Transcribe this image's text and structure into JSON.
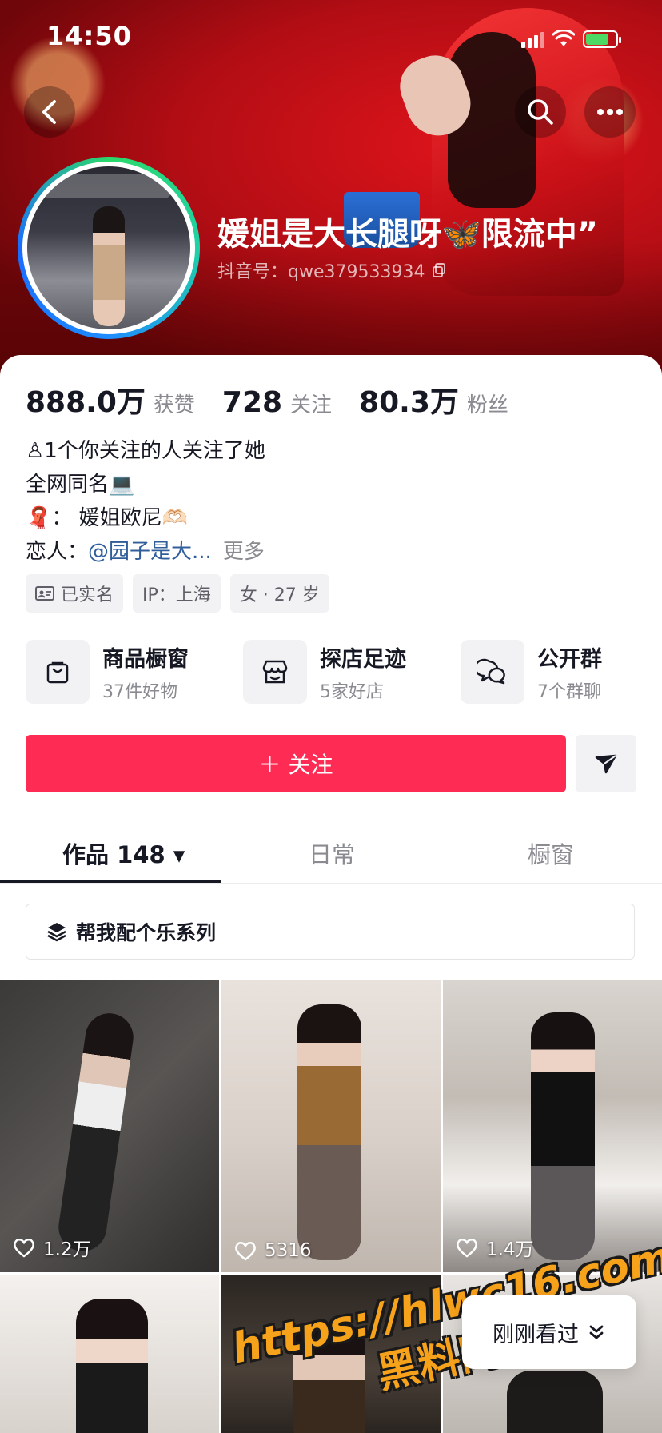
{
  "status_bar": {
    "time": "14:50"
  },
  "profile": {
    "nickname": "媛姐是大长腿呀🦋限流中”",
    "douyin_id": "抖音号：qwe379533934"
  },
  "stats": [
    {
      "value": "888.0万",
      "label": "获赞"
    },
    {
      "value": "728",
      "label": "关注"
    },
    {
      "value": "80.3万",
      "label": "粉丝"
    }
  ],
  "bio": {
    "mutual": "♙1个你关注的人关注了她",
    "line2": "全网同名💻",
    "line3": "🧣： 媛姐欧尼🫶🏻",
    "lover_label": "恋人：",
    "lover_link": "@园子是大...",
    "more": "更多"
  },
  "tags": [
    {
      "icon": "id-card-icon",
      "text": "已实名"
    },
    {
      "text": "IP：上海"
    },
    {
      "text": "女 · 27 岁"
    }
  ],
  "shortcuts": [
    {
      "title": "商品橱窗",
      "sub": "37件好物",
      "icon": "shopping-bag-icon"
    },
    {
      "title": "探店足迹",
      "sub": "5家好店",
      "icon": "store-icon"
    },
    {
      "title": "公开群",
      "sub": "7个群聊",
      "icon": "chat-bubbles-icon"
    }
  ],
  "follow_button": "＋ 关注",
  "tabs": [
    {
      "label": "作品 148 ▾"
    },
    {
      "label": "日常"
    },
    {
      "label": "橱窗"
    }
  ],
  "series_prompt": "帮我配个乐系列",
  "videos": [
    {
      "likes": "1.2万"
    },
    {
      "likes": "5316"
    },
    {
      "likes": "1.4万"
    },
    {
      "likes": ""
    },
    {
      "likes": ""
    },
    {
      "likes": ""
    }
  ],
  "recent_pill": "刚刚看过",
  "watermark": {
    "line1": "https://hlwc16.com",
    "line2": "黑料网"
  },
  "colors": {
    "accent": "#fe2c55",
    "link": "#2f5e9a"
  }
}
